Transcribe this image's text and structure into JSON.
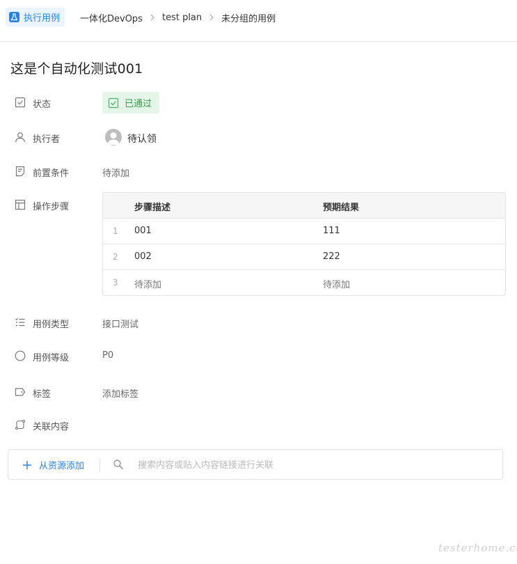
{
  "header": {
    "exec_tag": "执行用例",
    "breadcrumbs": [
      "一体化DevOps",
      "test plan",
      "未分组的用例"
    ]
  },
  "title": "这是个自动化测试001",
  "fields": {
    "status": {
      "label": "状态",
      "value": "已通过",
      "icon": "checkbox-icon"
    },
    "executor": {
      "label": "执行者",
      "value": "待认领",
      "icon": "user-icon"
    },
    "precondition": {
      "label": "前置条件",
      "value": "待添加",
      "icon": "document-icon"
    },
    "steps": {
      "label": "操作步骤",
      "icon": "table-icon"
    },
    "case_type": {
      "label": "用例类型",
      "value": "接口测试",
      "icon": "list-icon"
    },
    "case_level": {
      "label": "用例等级",
      "value": "P0",
      "icon": "circle-icon"
    },
    "tags": {
      "label": "标签",
      "value": "添加标签",
      "icon": "tag-icon"
    },
    "related": {
      "label": "关联内容",
      "icon": "link-icon"
    }
  },
  "steps_table": {
    "headers": [
      "步骤描述",
      "预期结果"
    ],
    "rows": [
      {
        "num": "1",
        "desc": "001",
        "expected": "111"
      },
      {
        "num": "2",
        "desc": "002",
        "expected": "222"
      },
      {
        "num": "3",
        "desc": "待添加",
        "expected": "待添加"
      }
    ]
  },
  "relation": {
    "add_label": "从资源添加",
    "search_placeholder": "搜索内容或贴入内容链接进行关联"
  },
  "watermark": "testerhome.com",
  "colors": {
    "accent": "#2a82e4",
    "success": "#2d9a47",
    "success_bg": "#e5f6e8"
  }
}
